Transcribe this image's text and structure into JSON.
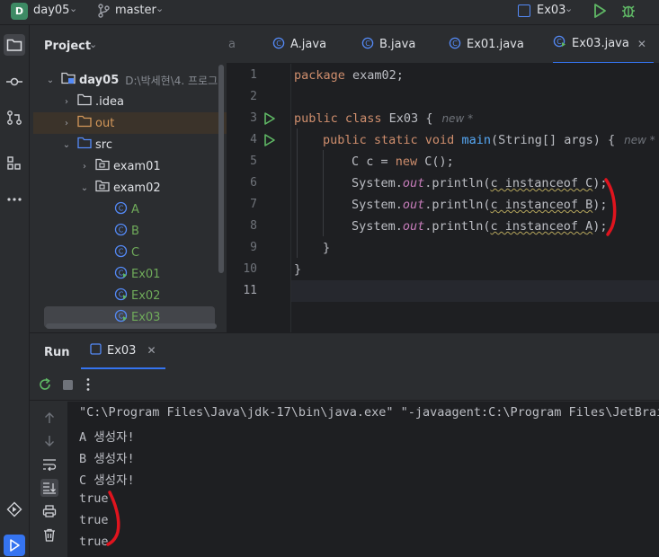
{
  "titlebar": {
    "project_badge": "D",
    "project_name": "day05",
    "branch": "master",
    "run_config": "Ex03"
  },
  "toolstrip": {
    "icons": [
      "folder-icon",
      "commit-icon",
      "pull-requests-icon",
      "structure-icon",
      "more-icon",
      "services-icon",
      "run-icon"
    ]
  },
  "project": {
    "title": "Project",
    "tree": [
      {
        "label": "day05",
        "path": "D:\\박세현\\4. 프로그"
      },
      {
        "label": ".idea"
      },
      {
        "label": "out"
      },
      {
        "label": "src"
      },
      {
        "label": "exam01"
      },
      {
        "label": "exam02"
      },
      {
        "label": "A"
      },
      {
        "label": "B"
      },
      {
        "label": "C"
      },
      {
        "label": "Ex01"
      },
      {
        "label": "Ex02"
      },
      {
        "label": "Ex03"
      }
    ]
  },
  "editor": {
    "tabs": [
      {
        "label": "a"
      },
      {
        "label": "A.java"
      },
      {
        "label": "B.java"
      },
      {
        "label": "Ex01.java"
      },
      {
        "label": "Ex03.java"
      }
    ],
    "line_numbers": [
      "1",
      "2",
      "3",
      "4",
      "5",
      "6",
      "7",
      "8",
      "9",
      "10",
      "11"
    ],
    "code": {
      "l1_kw": "package",
      "l1_rest": " exam02;",
      "l3_kw": "public class",
      "l3_rest": " Ex03 {",
      "l3_hint": "new *",
      "l4_kw1": "public static void",
      "l4_fn": " main",
      "l4_rest": "(String[] args) {",
      "l4_hint": "new *",
      "l5_a": "C c = ",
      "l5_kw": "new",
      "l5_b": " C();",
      "sys": "System.",
      "out": "out",
      "println": ".println(",
      "c_inst": "c instanceof ",
      "l6_cls": "C",
      "l7_cls": "B",
      "l8_cls": "A",
      "close_paren": ");",
      "l9": "}",
      "l10": "}"
    }
  },
  "run": {
    "title": "Run",
    "tab": "Ex03",
    "console": [
      "\"C:\\Program Files\\Java\\jdk-17\\bin\\java.exe\" \"-javaagent:C:\\Program Files\\JetBrains",
      "A 생성자!",
      "B 생성자!",
      "C 생성자!",
      "true",
      "true",
      "true"
    ]
  },
  "colors": {
    "accent": "#3574f0",
    "keyword": "#cf8e6d",
    "method": "#56a8f5",
    "static_field": "#c77dbb",
    "annotation_red": "#e0141e",
    "run_green": "#5fb865"
  }
}
